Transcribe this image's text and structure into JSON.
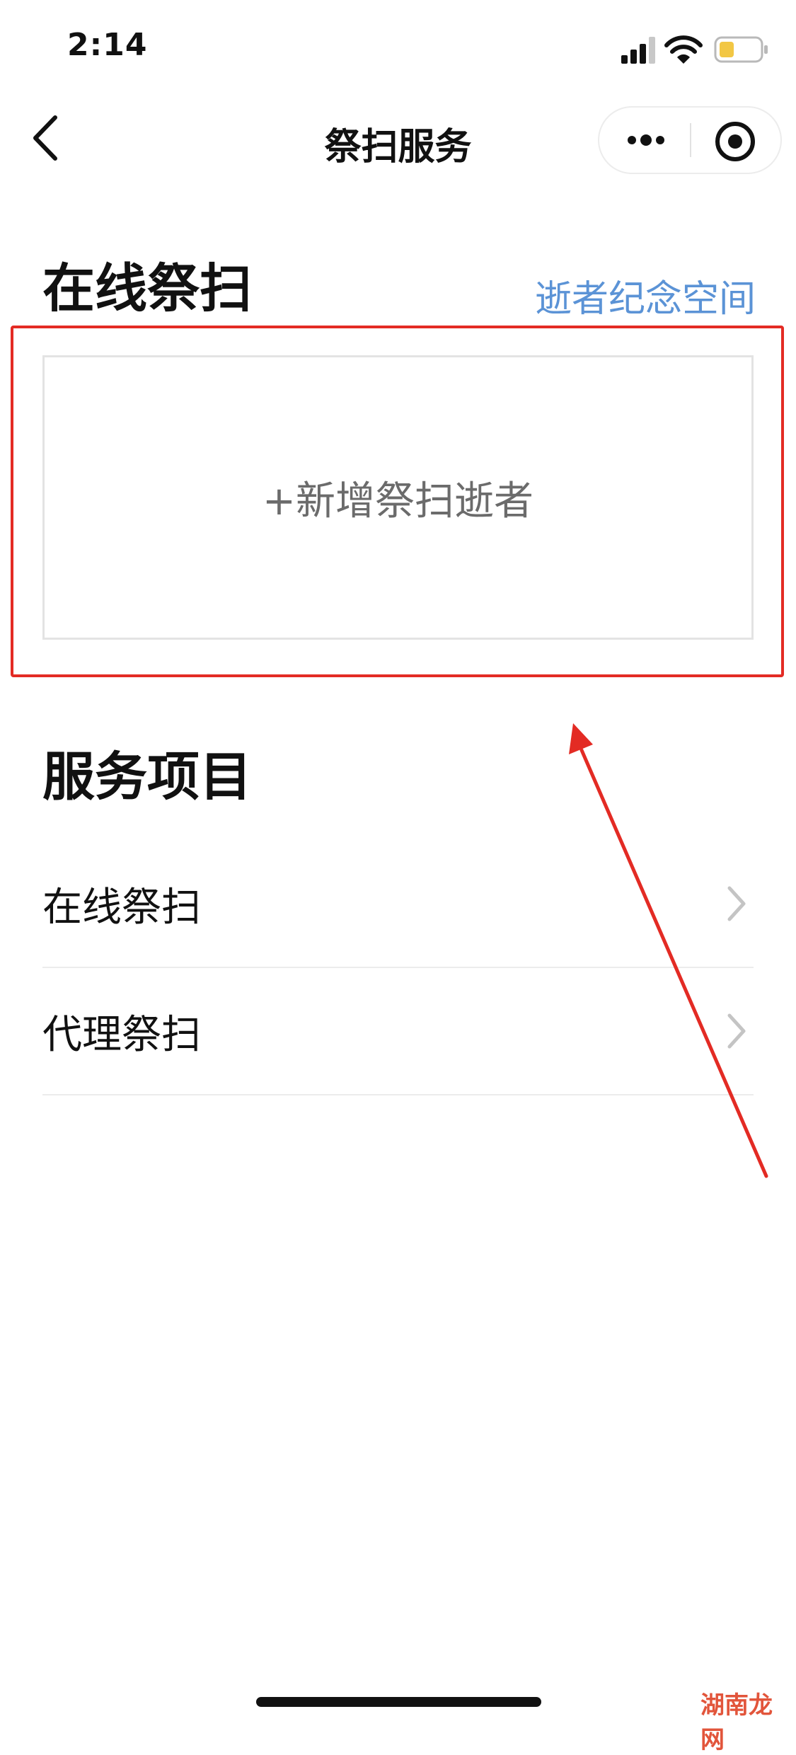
{
  "status_bar": {
    "time": "2:14"
  },
  "nav": {
    "title": "祭扫服务"
  },
  "online_section": {
    "title": "在线祭扫",
    "memorial_link": "逝者纪念空间",
    "add_card_label": "+新增祭扫逝者"
  },
  "services_section": {
    "title": "服务项目",
    "items": [
      {
        "label": "在线祭扫"
      },
      {
        "label": "代理祭扫"
      }
    ]
  },
  "watermark": "湖南龙网",
  "colors": {
    "accent_link": "#5b93d6",
    "highlight_red": "#e32b24",
    "battery_level": "#f2c744"
  },
  "icons": {
    "back": "chevron-left-icon",
    "more": "more-dots-icon",
    "close": "target-close-icon",
    "item_arrow": "chevron-right-icon"
  }
}
